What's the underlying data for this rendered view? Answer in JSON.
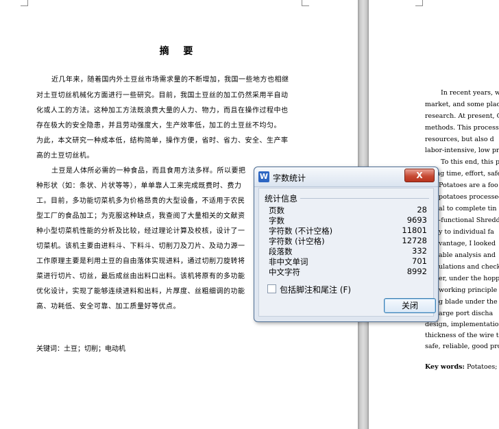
{
  "document": {
    "left_page": {
      "title": "摘 要",
      "lines": [
        "近几年来，随着国内外土豆丝市场需求量的不断增加，我国一些地方也相继",
        "对土豆切丝机械化方面进行一些研究。目前，我国土豆丝的加工仍然采用半自动",
        "化或人工的方法。这种加工方法既浪费大量的人力、物力，而且在操作过程中也",
        "存在极大的安全隐患，并且劳动强度大，生产效率低，加工的土豆丝不均匀。",
        "为此，本文研究一种成本低，结构简单，操作方便，省时、省力、安全、生产率",
        "高的土豆切丝机。",
        "土豆是人体所必需的一种食品，而且食用方法多样。所以要把",
        "种形状（如：条状、片状等等），单单靠人工来完成既费时、费力",
        "工。目前，多功能切菜机多为价格昂贵的大型设备，不适用于农民",
        "型工厂的食品加工；为克服这种缺点，我查阅了大量相关的文献资",
        "种小型切菜机性能的分析及比较，经过理论计算及校核，设计了一",
        "切菜机。该机主要由进料斗、下料斗、切削刀及刀片、及动力源一",
        "工作原理主要是利用土豆的自由落体实现进料，通过切削刀旋转将",
        "菜进行切片、切丝，最后成丝由出料口出料。该机将原有的多功能",
        "优化设计，实现了能够连续进料和出料，片厚度、丝粗细调的功能",
        "高、功耗低、安全可靠、加工质量好等优点。"
      ],
      "keywords": "关键词：土豆；切削；电动机"
    },
    "right_page": {
      "lines": [
        "In recent years, wi",
        "market, and some plac",
        "research. At present, C",
        "methods. This processi",
        "resources, but also d",
        "labor-intensive, low pro",
        "To this end, this p",
        "ng time, effort, safe",
        "Potatoes are a foo",
        "potatoes processed",
        "al to complete tin",
        "-functional Shredd",
        "y to individual fa",
        "vantage, I looked",
        "able analysis and",
        "ulations and check",
        "er, under the hoppe",
        "working principle",
        "g blade under the",
        "arge port discha",
        "design, implementation",
        "thickness of the wire t",
        "safe, reliable, good proc"
      ],
      "keywords_label": "Key words:",
      "keywords_value": "Potatoes;"
    }
  },
  "dialog": {
    "title": "字数统计",
    "close_x": "X",
    "group_title": "统计信息",
    "stats": [
      {
        "label": "页数",
        "value": "28"
      },
      {
        "label": "字数",
        "value": "9693"
      },
      {
        "label": "字符数 (不计空格)",
        "value": "11801"
      },
      {
        "label": "字符数 (计空格)",
        "value": "12728"
      },
      {
        "label": "段落数",
        "value": "332"
      },
      {
        "label": "非中文单词",
        "value": "701"
      },
      {
        "label": "中文字符",
        "value": "8992"
      }
    ],
    "checkbox_label": "包括脚注和尾注 (F)",
    "checkbox_checked": false,
    "close_button": "关闭"
  }
}
